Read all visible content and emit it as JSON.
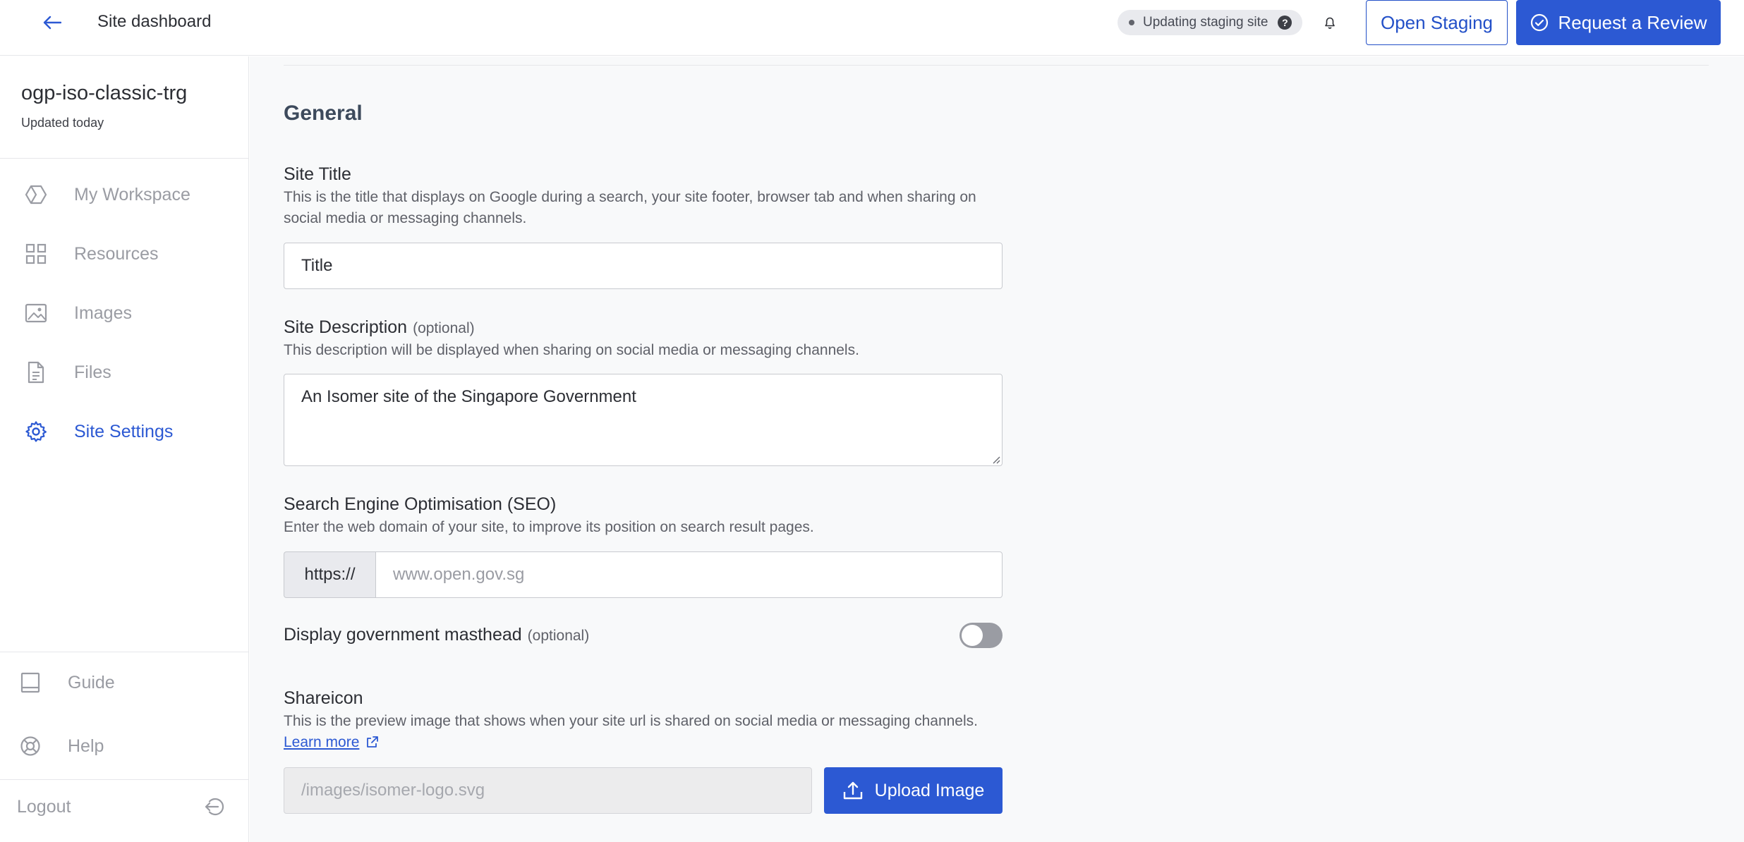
{
  "header": {
    "title": "Site dashboard",
    "status_text": "Updating staging site",
    "status_help": "?",
    "open_staging_label": "Open Staging",
    "request_review_label": "Request a Review"
  },
  "sidebar": {
    "site_name": "ogp-iso-classic-trg",
    "updated": "Updated today",
    "items": [
      {
        "label": "My Workspace",
        "icon": "workspace-icon",
        "active": false
      },
      {
        "label": "Resources",
        "icon": "grid-icon",
        "active": false
      },
      {
        "label": "Images",
        "icon": "image-icon",
        "active": false
      },
      {
        "label": "Files",
        "icon": "file-icon",
        "active": false
      },
      {
        "label": "Site Settings",
        "icon": "gear-icon",
        "active": true
      }
    ],
    "guide_label": "Guide",
    "help_label": "Help",
    "logout_label": "Logout"
  },
  "main": {
    "section_heading": "General",
    "site_title": {
      "label": "Site Title",
      "help": "This is the title that displays on Google during a search, your site footer, browser tab and when sharing on social media or messaging channels.",
      "value": "Title"
    },
    "site_description": {
      "label": "Site Description",
      "optional": "(optional)",
      "help": "This description will be displayed when sharing on social media or messaging channels.",
      "value": "An Isomer site of the Singapore Government"
    },
    "seo": {
      "label": "Search Engine Optimisation (SEO)",
      "help": "Enter the web domain of your site, to improve its position on search result pages.",
      "prefix": "https://",
      "placeholder": "www.open.gov.sg"
    },
    "masthead": {
      "label": "Display government masthead",
      "optional": "(optional)",
      "enabled": false
    },
    "shareicon": {
      "label": "Shareicon",
      "help": "This is the preview image that shows when your site url is shared on social media or messaging channels.",
      "learn_more": "Learn more",
      "value": "/images/isomer-logo.svg",
      "upload_label": "Upload Image"
    }
  },
  "colors": {
    "accent": "#2c59d3",
    "muted": "#9a9ca3"
  }
}
